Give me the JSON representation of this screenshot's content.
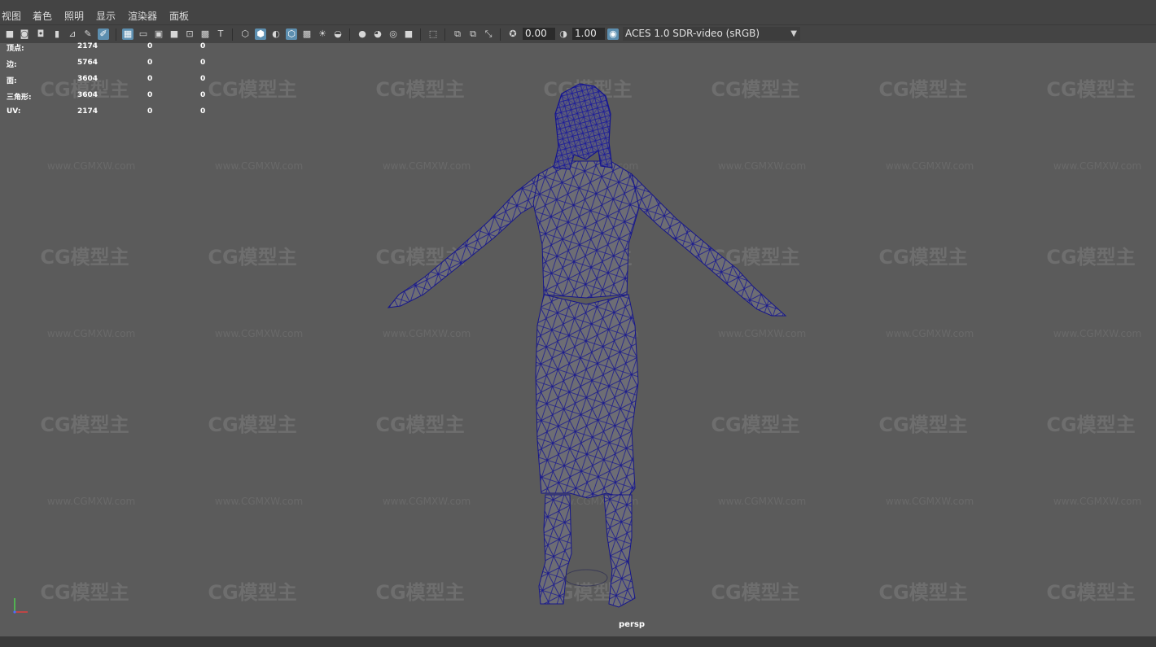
{
  "menu": [
    "视图",
    "着色",
    "照明",
    "显示",
    "渲染器",
    "面板"
  ],
  "toolbar": {
    "exposure_value": "0.00",
    "gamma_value": "1.00",
    "colorspace_label": "ACES 1.0 SDR-video (sRGB)",
    "accent_color": "#5d8fb0"
  },
  "hud": {
    "rows": [
      {
        "label": "顶点:",
        "v1": "2174",
        "v2": "0",
        "v3": "0"
      },
      {
        "label": "边:",
        "v1": "5764",
        "v2": "0",
        "v3": "0"
      },
      {
        "label": "面:",
        "v1": "3604",
        "v2": "0",
        "v3": "0"
      },
      {
        "label": "三角形:",
        "v1": "3604",
        "v2": "0",
        "v3": "0"
      },
      {
        "label": "UV:",
        "v1": "2174",
        "v2": "0",
        "v3": "0"
      }
    ]
  },
  "watermark": {
    "logo_text": "CG模型主",
    "url_text": "www.CGMXW.com"
  },
  "viewport": {
    "camera_label": "persp",
    "wire_color": "#1a1a8c",
    "mesh_color": "#6f6f75"
  },
  "axis": {
    "x_label": "x",
    "y_label": "y"
  }
}
